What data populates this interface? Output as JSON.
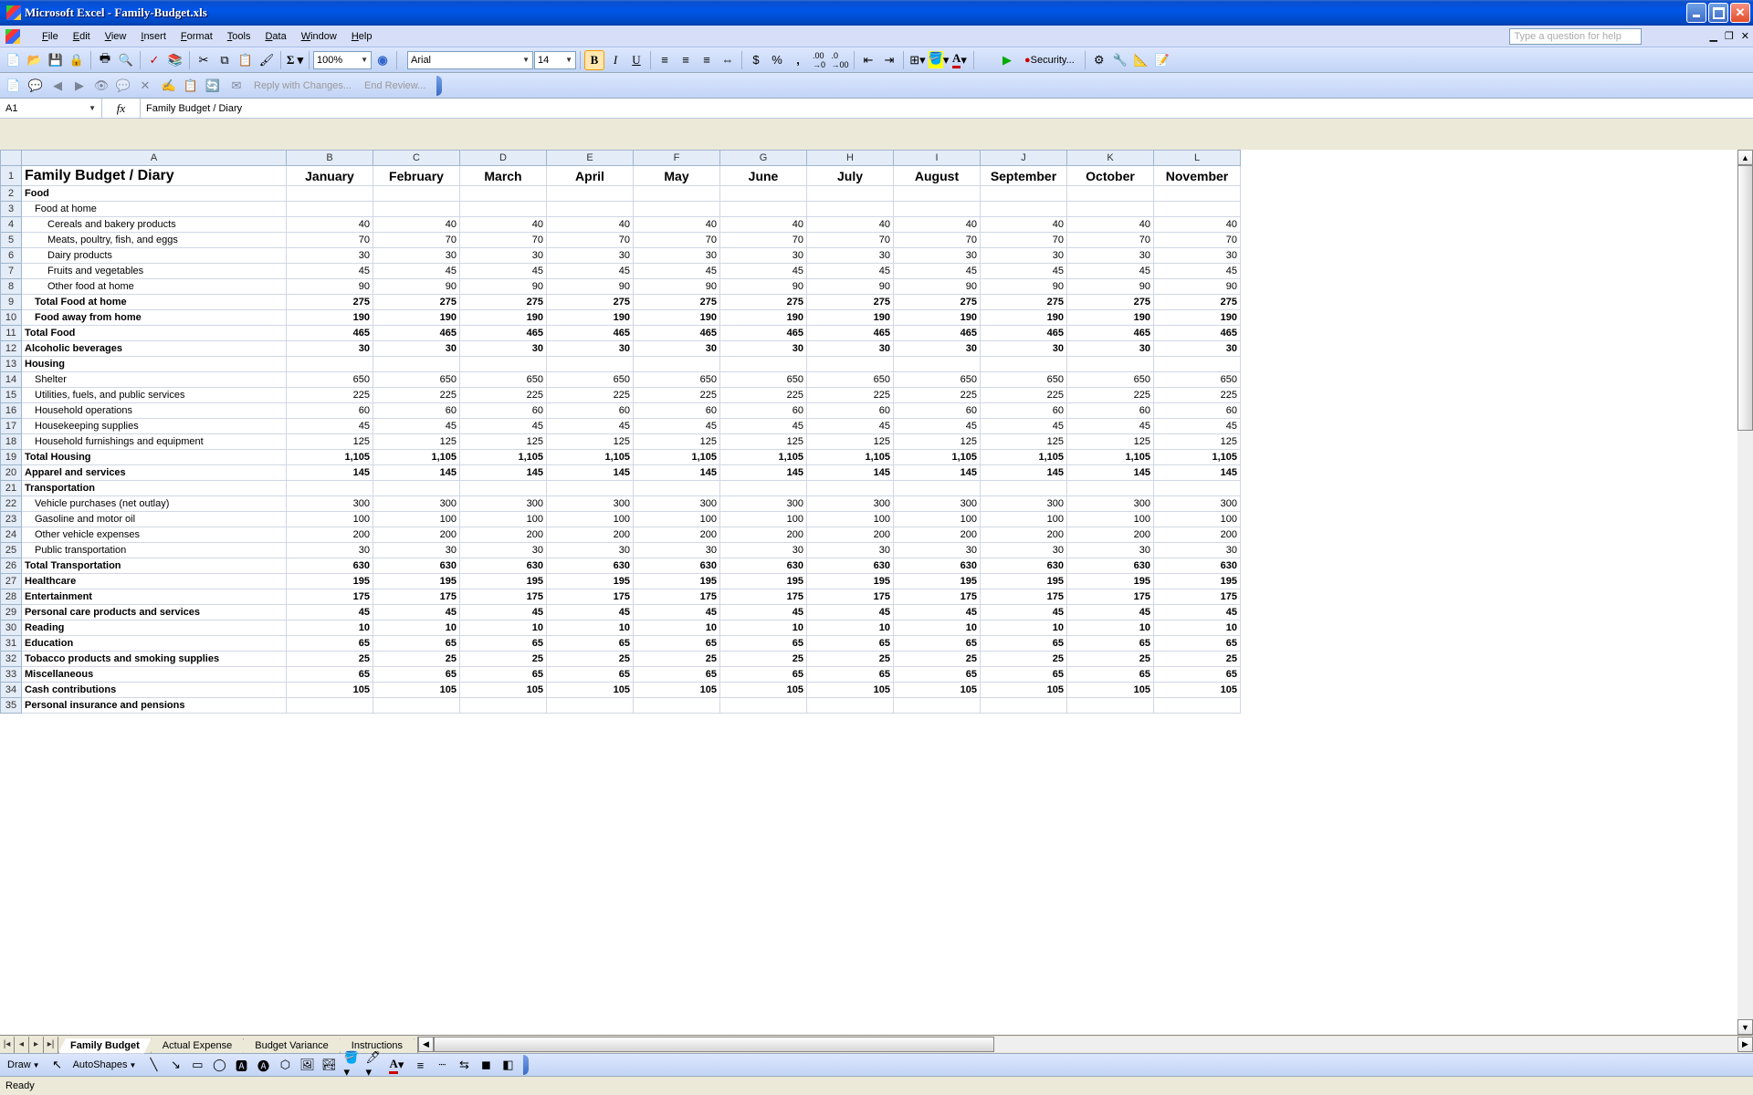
{
  "title_bar": {
    "app": "Microsoft Excel",
    "filename": "Family-Budget.xls"
  },
  "menus": [
    "File",
    "Edit",
    "View",
    "Insert",
    "Format",
    "Tools",
    "Data",
    "Window",
    "Help"
  ],
  "help_placeholder": "Type a question for help",
  "zoom": "100%",
  "font_name": "Arial",
  "font_size": "14",
  "security_label": "Security...",
  "review": {
    "reply": "Reply with Changes...",
    "end": "End Review..."
  },
  "name_box": "A1",
  "formula": "Family Budget / Diary",
  "fx": "fx",
  "columns": [
    "A",
    "B",
    "C",
    "D",
    "E",
    "F",
    "G",
    "H",
    "I",
    "J",
    "K",
    "L"
  ],
  "month_headers": [
    "January",
    "February",
    "March",
    "April",
    "May",
    "June",
    "July",
    "August",
    "September",
    "October",
    "November"
  ],
  "rows": [
    {
      "n": 1,
      "label": "Family Budget / Diary",
      "cls": "r1 hdr",
      "lcls": "bold",
      "vals": [
        "January",
        "February",
        "March",
        "April",
        "May",
        "June",
        "July",
        "August",
        "September",
        "October",
        "November"
      ],
      "isHeader": true
    },
    {
      "n": 2,
      "label": "Food",
      "lcls": "bold"
    },
    {
      "n": 3,
      "label": "Food at home",
      "lcls": "ind1"
    },
    {
      "n": 4,
      "label": "Cereals and bakery products",
      "lcls": "ind2",
      "v": 40
    },
    {
      "n": 5,
      "label": "Meats, poultry, fish, and eggs",
      "lcls": "ind2",
      "v": 70
    },
    {
      "n": 6,
      "label": "Dairy products",
      "lcls": "ind2",
      "v": 30
    },
    {
      "n": 7,
      "label": "Fruits and vegetables",
      "lcls": "ind2",
      "v": 45
    },
    {
      "n": 8,
      "label": "Other food at home",
      "lcls": "ind2",
      "v": 90
    },
    {
      "n": 9,
      "label": "Total Food at home",
      "lcls": "ind1 bold",
      "v": 275,
      "bold": true
    },
    {
      "n": 10,
      "label": "Food away from home",
      "lcls": "ind1 bold",
      "v": 190,
      "bold": true
    },
    {
      "n": 11,
      "label": "Total Food",
      "lcls": "bold",
      "v": 465,
      "bold": true
    },
    {
      "n": 12,
      "label": "Alcoholic beverages",
      "lcls": "bold",
      "v": 30,
      "bold": true
    },
    {
      "n": 13,
      "label": "Housing",
      "lcls": "bold"
    },
    {
      "n": 14,
      "label": "Shelter",
      "lcls": "ind1",
      "v": 650
    },
    {
      "n": 15,
      "label": "Utilities, fuels, and public services",
      "lcls": "ind1",
      "v": 225
    },
    {
      "n": 16,
      "label": "Household operations",
      "lcls": "ind1",
      "v": 60
    },
    {
      "n": 17,
      "label": "Housekeeping supplies",
      "lcls": "ind1",
      "v": 45
    },
    {
      "n": 18,
      "label": "Household furnishings and equipment",
      "lcls": "ind1",
      "v": 125
    },
    {
      "n": 19,
      "label": "Total Housing",
      "lcls": "bold",
      "v": "1,105",
      "bold": true
    },
    {
      "n": 20,
      "label": "Apparel and services",
      "lcls": "bold",
      "v": 145,
      "bold": true
    },
    {
      "n": 21,
      "label": "Transportation",
      "lcls": "bold"
    },
    {
      "n": 22,
      "label": "Vehicle purchases (net outlay)",
      "lcls": "ind1",
      "v": 300
    },
    {
      "n": 23,
      "label": "Gasoline and motor oil",
      "lcls": "ind1",
      "v": 100
    },
    {
      "n": 24,
      "label": "Other vehicle expenses",
      "lcls": "ind1",
      "v": 200
    },
    {
      "n": 25,
      "label": "Public transportation",
      "lcls": "ind1",
      "v": 30
    },
    {
      "n": 26,
      "label": "Total Transportation",
      "lcls": "bold",
      "v": 630,
      "bold": true
    },
    {
      "n": 27,
      "label": "Healthcare",
      "lcls": "bold",
      "v": 195,
      "bold": true
    },
    {
      "n": 28,
      "label": "Entertainment",
      "lcls": "bold",
      "v": 175,
      "bold": true
    },
    {
      "n": 29,
      "label": "Personal care products and services",
      "lcls": "bold",
      "v": 45,
      "bold": true
    },
    {
      "n": 30,
      "label": "Reading",
      "lcls": "bold",
      "v": 10,
      "bold": true
    },
    {
      "n": 31,
      "label": "Education",
      "lcls": "bold",
      "v": 65,
      "bold": true
    },
    {
      "n": 32,
      "label": "Tobacco products and smoking supplies",
      "lcls": "bold",
      "v": 25,
      "bold": true
    },
    {
      "n": 33,
      "label": "Miscellaneous",
      "lcls": "bold",
      "v": 65,
      "bold": true
    },
    {
      "n": 34,
      "label": "Cash contributions",
      "lcls": "bold",
      "v": 105,
      "bold": true
    },
    {
      "n": 35,
      "label": "Personal insurance and pensions",
      "lcls": "bold"
    }
  ],
  "sheet_tabs": [
    "Family Budget",
    "Actual Expense",
    "Budget Variance",
    "Instructions"
  ],
  "active_tab": 0,
  "draw_label": "Draw",
  "autoshapes": "AutoShapes",
  "status": "Ready"
}
